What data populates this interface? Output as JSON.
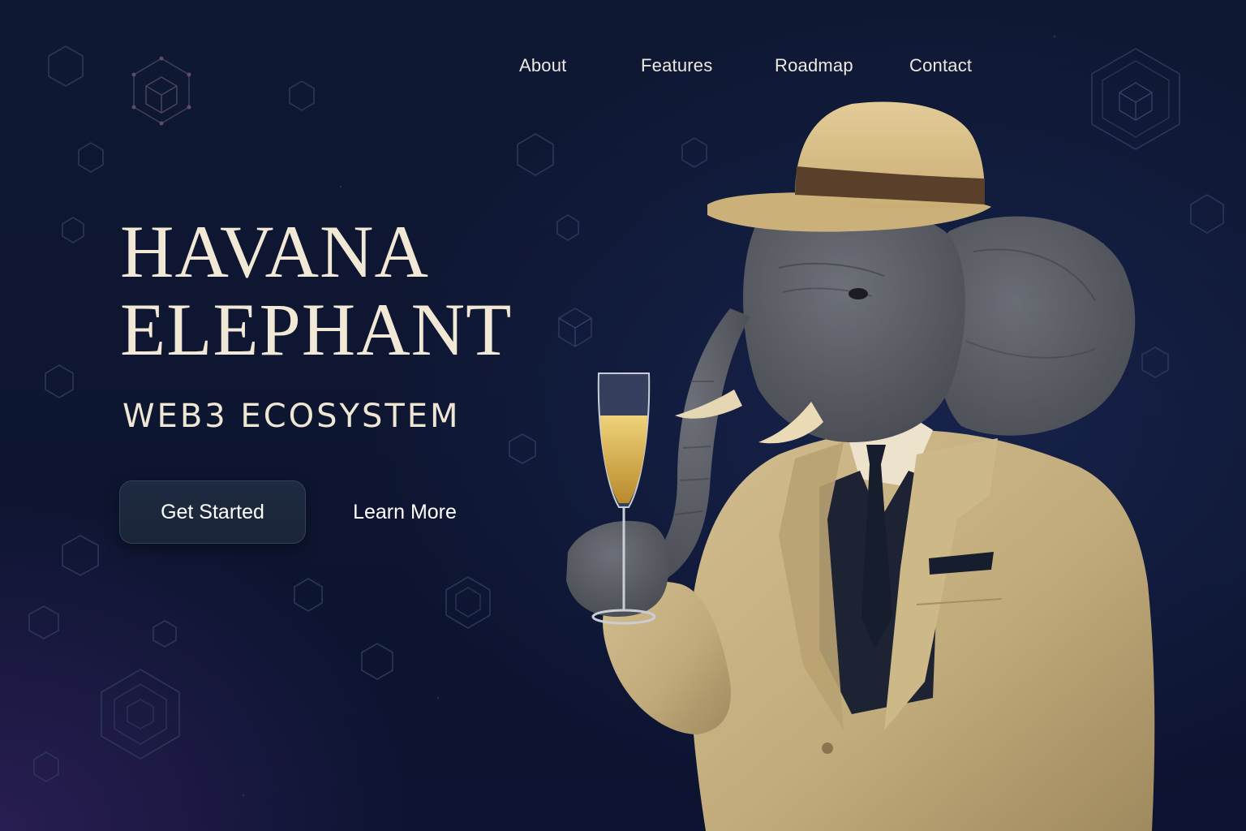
{
  "nav": {
    "items": [
      {
        "label": "About"
      },
      {
        "label": "Features"
      },
      {
        "label": "Roadmap"
      },
      {
        "label": "Contact"
      }
    ]
  },
  "hero": {
    "title_line1": "HAVANA",
    "title_line2": "ELEPHANT",
    "subtitle": "WEB3 ECOSYSTEM",
    "primary_button": "Get Started",
    "secondary_button": "Learn More"
  },
  "illustration": {
    "subject": "elephant-in-suit-with-champagne"
  },
  "colors": {
    "background": "#0e1631",
    "title_text": "#f1e8d6",
    "nav_text": "#ece8e2",
    "button_background": "#1c2639",
    "suit": "#c9b385",
    "hat": "#d9c08b",
    "hat_band": "#5a3f2a",
    "elephant_skin": "#5d6068",
    "champagne": "#d8b04c",
    "hexagon_outline": "#2b3658"
  }
}
